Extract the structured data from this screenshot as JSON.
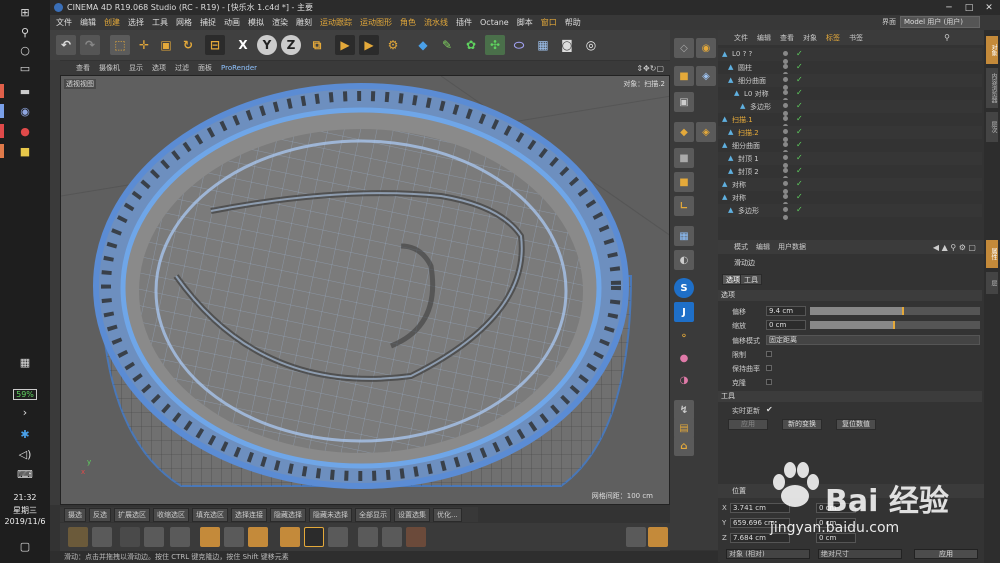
{
  "titlebar": {
    "title": "CINEMA 4D R19.068 Studio (RC - R19) - [快乐水 1.c4d *] - 主要",
    "minimize": "─",
    "maximize": "□",
    "close": "✕"
  },
  "menubar": {
    "items": [
      "文件",
      "编辑",
      "创建",
      "选择",
      "工具",
      "网格",
      "捕捉",
      "动画",
      "模拟",
      "渲染",
      "雕刻",
      "运动跟踪",
      "运动图形",
      "角色",
      "流水线",
      "插件",
      "Octane",
      "脚本",
      "窗口",
      "帮助"
    ],
    "highlighted": [
      "创建",
      "运动跟踪",
      "运动图形",
      "角色",
      "流水线",
      "窗口"
    ],
    "layout_label": "界面",
    "layout_value": "Model 用户 (用户)"
  },
  "viewport": {
    "menu": [
      "查看",
      "摄像机",
      "显示",
      "选项",
      "过滤",
      "面板",
      "ProRender"
    ],
    "active_menu": "ProRender",
    "view_label": "透视视图",
    "object_label": "对象：扫描.2",
    "grid_label": "网格间距：100 cm",
    "axis_x": "x",
    "axis_y": "y"
  },
  "bottom_tabs": [
    "摄选",
    "反选",
    "扩展选区",
    "收缩选区",
    "填充选区",
    "选择连接",
    "隐藏选择",
    "隐藏未选择",
    "全部显示",
    "设置选集",
    "优化..."
  ],
  "statusbar": {
    "text": "滑动：点击并拖拽以滑动边。按住 CTRL 键克隆边，按住 Shift 键移元素"
  },
  "object_manager": {
    "menu": [
      "文件",
      "编辑",
      "查看",
      "对象",
      "标签",
      "书签"
    ],
    "active_menu": "标签",
    "rows": [
      {
        "name": "L0 ? ?",
        "indent": 0,
        "selected": false
      },
      {
        "name": "圆柱",
        "indent": 1,
        "selected": false
      },
      {
        "name": "细分曲面",
        "indent": 1,
        "selected": false
      },
      {
        "name": "L0 对称",
        "indent": 2,
        "selected": false
      },
      {
        "name": "多边形",
        "indent": 3,
        "selected": false
      },
      {
        "name": "扫描.1",
        "indent": 0,
        "selected": true
      },
      {
        "name": "扫描.2",
        "indent": 1,
        "selected": true
      },
      {
        "name": "细分曲面",
        "indent": 0,
        "selected": false
      },
      {
        "name": "封顶 1",
        "indent": 1,
        "selected": false
      },
      {
        "name": "封顶 2",
        "indent": 1,
        "selected": false
      },
      {
        "name": "对称",
        "indent": 0,
        "selected": false
      },
      {
        "name": "对称",
        "indent": 0,
        "selected": false
      },
      {
        "name": "多边形",
        "indent": 1,
        "selected": false
      }
    ]
  },
  "attribute_manager": {
    "menu": [
      "模式",
      "编辑",
      "用户数据"
    ],
    "tool_name": "滑动边",
    "tabs": [
      "选项",
      "工具"
    ],
    "section_options": "选项",
    "offset_label": "偏移",
    "offset_value": "9.4 cm",
    "offset_fraction": 0.55,
    "scale_label": "缩放",
    "scale_value": "0 cm",
    "scale_fraction": 0.5,
    "offset_mode_label": "偏移模式",
    "offset_mode_value": "固定距离",
    "limit_label": "限制",
    "keep_curvature_label": "保持曲率",
    "clone_label": "克隆",
    "section_tool": "工具",
    "realtime_label": "实时更新",
    "realtime_check": "✔",
    "apply_btn": "应用",
    "new_transform_btn": "新的变换",
    "reset_btn": "复位数值"
  },
  "coordinates": {
    "header": "位置",
    "x_label": "X",
    "x_value": "3.741 cm",
    "y_label": "Y",
    "y_value": "659.696 cm",
    "z_label": "Z",
    "z_value": "7.684 cm",
    "x2_value": "0 cm",
    "y2_value": "0 cm",
    "z2_value": "0 cm",
    "obj_mode": "对象 (相对)",
    "size_mode": "绝对尺寸",
    "apply": "应用"
  },
  "taskbar": {
    "battery": "59%",
    "time": "21:32",
    "weekday": "星期三",
    "date": "2019/11/6"
  },
  "right_tabs": [
    "对象",
    "内容浏览器",
    "层次",
    "属性",
    "层"
  ],
  "watermark": {
    "logo_text": "Bai 经验",
    "url": "jingyan.baidu.com"
  },
  "colors": {
    "accent": "#e4a93a",
    "mesh_blue": "#6fa6e8",
    "viewport_bg": "#5f5f5f"
  }
}
